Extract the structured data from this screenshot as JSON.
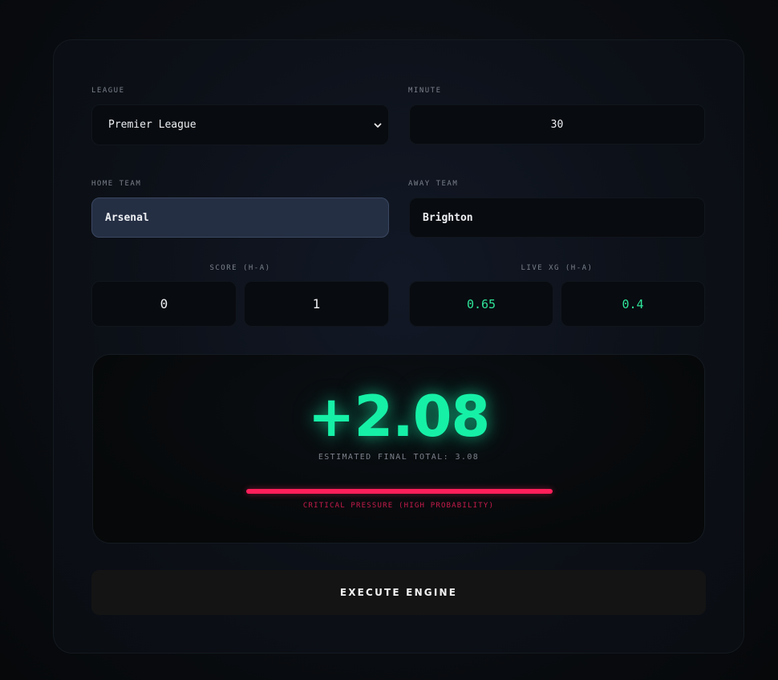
{
  "form": {
    "league": {
      "label": "LEAGUE",
      "value": "Premier League"
    },
    "minute": {
      "label": "MINUTE",
      "value": "30"
    },
    "home_team": {
      "label": "HOME TEAM",
      "value": "Arsenal"
    },
    "away_team": {
      "label": "AWAY TEAM",
      "value": "Brighton"
    },
    "score": {
      "label": "SCORE (H-A)",
      "home": "0",
      "away": "1"
    },
    "live_xg": {
      "label": "LIVE XG (H-A)",
      "home": "0.65",
      "away": "0.4"
    }
  },
  "result": {
    "delta": "+2.08",
    "estimate_text": "ESTIMATED FINAL TOTAL: 3.08",
    "pressure_text": "CRITICAL PRESSURE (HIGH PROBABILITY)",
    "colors": {
      "delta": "#16f0a6",
      "pressure": "#ff1f5a"
    }
  },
  "actions": {
    "execute_label": "EXECUTE ENGINE"
  },
  "icons": {
    "league_dropdown": "chevron-down-icon"
  }
}
